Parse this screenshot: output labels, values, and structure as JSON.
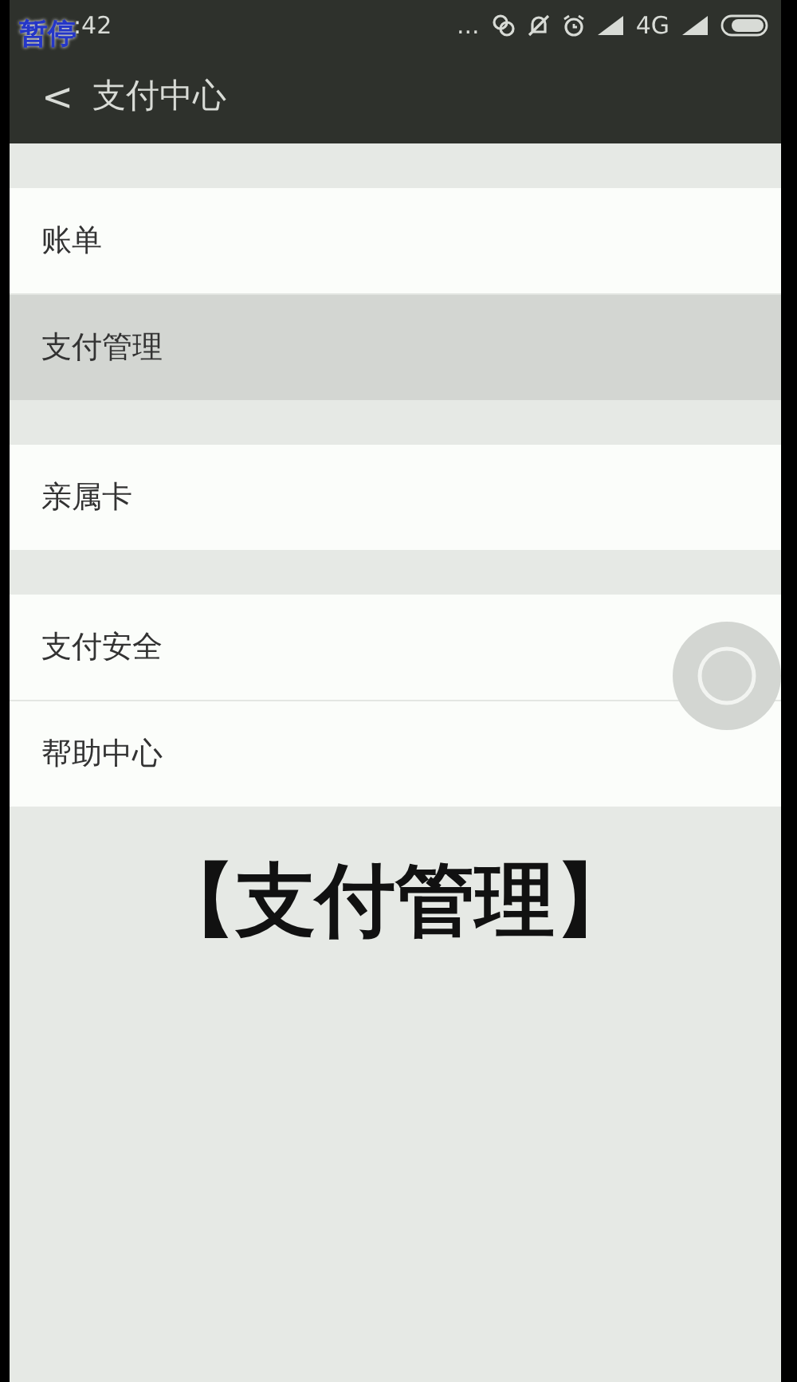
{
  "overlay_label": "暂停",
  "status_bar": {
    "time": ":42",
    "more": "...",
    "network": "4G"
  },
  "header": {
    "back": "<",
    "title": "支付中心"
  },
  "groups": [
    {
      "items": [
        {
          "label": "账单",
          "selected": false
        },
        {
          "label": "支付管理",
          "selected": true
        }
      ]
    },
    {
      "items": [
        {
          "label": "亲属卡",
          "selected": false
        }
      ]
    },
    {
      "items": [
        {
          "label": "支付安全",
          "selected": false
        },
        {
          "label": "帮助中心",
          "selected": false
        }
      ]
    }
  ],
  "caption": "【支付管理】"
}
